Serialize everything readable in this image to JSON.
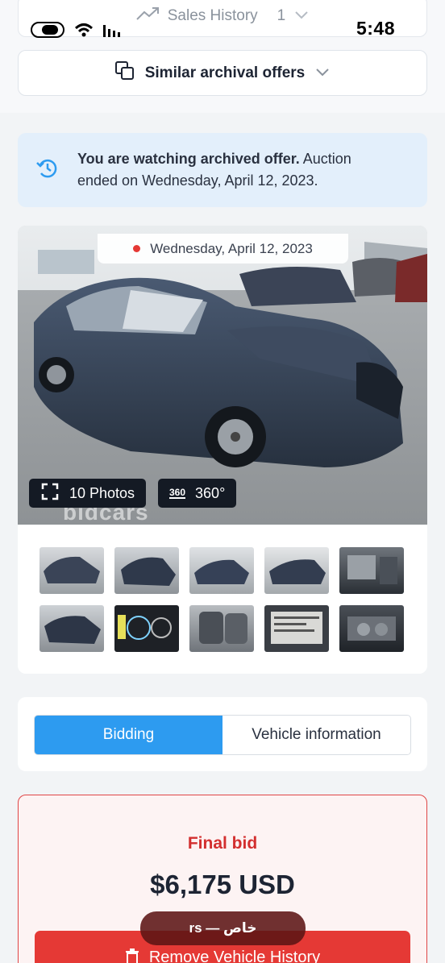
{
  "status_bar": {
    "time": "5:48"
  },
  "sales_history": {
    "label": "Sales History",
    "count": "1"
  },
  "similar_offers": {
    "label": "Similar archival offers"
  },
  "archived_notice": {
    "bold_text": "You are watching archived offer.",
    "rest_text": " Auction ended on Wednesday, April 12, 2023."
  },
  "gallery": {
    "date_label": "Wednesday, April 12, 2023",
    "photos_button": "10 Photos",
    "view360_badge": "360°",
    "view360_button": "360°",
    "watermark": "bidcars"
  },
  "tabs": [
    {
      "label": "Bidding",
      "active": true
    },
    {
      "label": "Vehicle information",
      "active": false
    }
  ],
  "final_bid": {
    "label": "Final bid",
    "amount": "$6,175 USD",
    "remove_button": "Remove Vehicle History"
  },
  "toast": {
    "text": "rs — خاص"
  },
  "colors": {
    "accent_blue": "#2d9bf0",
    "alert_red": "#e53935",
    "notice_bg": "#e3effb",
    "final_border": "#e04545"
  }
}
